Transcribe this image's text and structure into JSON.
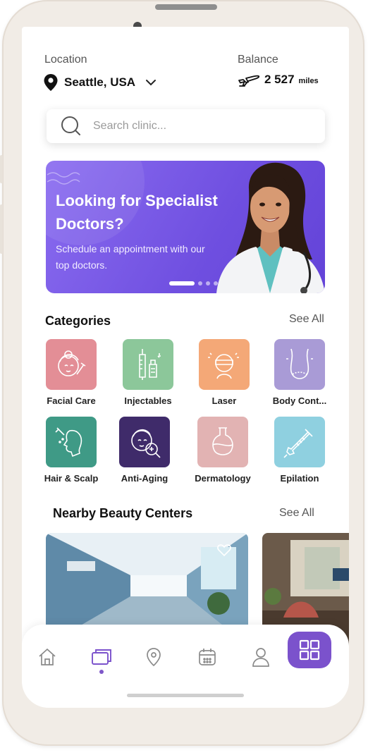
{
  "header": {
    "location_label": "Location",
    "location_value": "Seattle, USA",
    "balance_label": "Balance",
    "balance_value": "2 527",
    "balance_unit": "miles"
  },
  "search": {
    "placeholder": "Search clinic..."
  },
  "banner": {
    "title": "Looking for Specialist Doctors?",
    "subtitle": "Schedule an appointment with our top doctors.",
    "slide_count": 4,
    "active_slide": 1
  },
  "categories": {
    "title": "Categories",
    "see_all": "See All",
    "items": [
      {
        "label": "Facial Care",
        "color": "#e38e96"
      },
      {
        "label": "Injectables",
        "color": "#8cc79a"
      },
      {
        "label": "Laser",
        "color": "#f4a877"
      },
      {
        "label": "Body Cont...",
        "color": "#a99bd6"
      },
      {
        "label": "Hair & Scalp",
        "color": "#3f9a86"
      },
      {
        "label": "Anti-Aging",
        "color": "#3f2b6a"
      },
      {
        "label": "Dermatology",
        "color": "#e2b3b3"
      },
      {
        "label": "Epilation",
        "color": "#8fd0e0"
      }
    ]
  },
  "nearby": {
    "title": "Nearby Beauty Centers",
    "see_all": "See All"
  },
  "tabbar": {
    "items": [
      "home-icon",
      "cards-icon",
      "location-pin-icon",
      "calendar-icon",
      "profile-icon",
      "grid-icon"
    ],
    "active_color": "#7b52cc"
  }
}
